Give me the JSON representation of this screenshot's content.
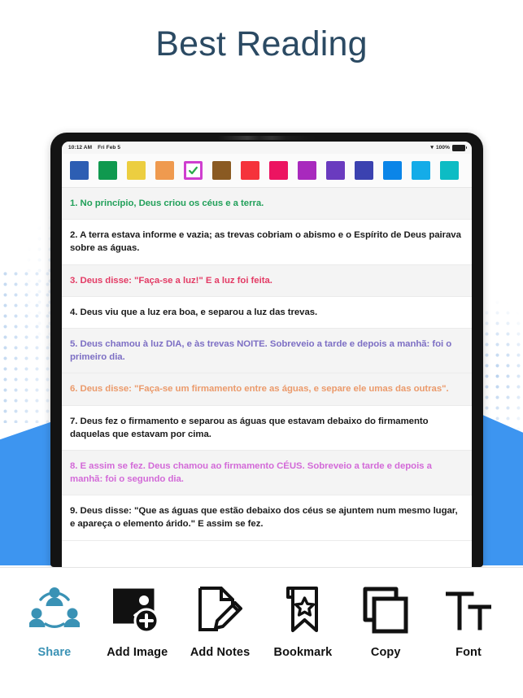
{
  "page": {
    "title": "Best Reading",
    "title_color": "#2b4a63",
    "accent_blue": "#3d95f0",
    "share_accent": "#3a92b5"
  },
  "tablet": {
    "status_bar": {
      "time": "10:12 AM",
      "date": "Fri Feb 5",
      "wifi_icon": "wifi-icon",
      "battery_percent": "100%",
      "battery_icon": "battery-full-icon"
    },
    "palette": {
      "swatches": [
        {
          "name": "blue",
          "color": "#2d5eb3",
          "selected": false
        },
        {
          "name": "green",
          "color": "#10994f",
          "selected": false
        },
        {
          "name": "yellow",
          "color": "#ecce40",
          "selected": false
        },
        {
          "name": "orange",
          "color": "#ef9a4f",
          "selected": false
        },
        {
          "name": "white-check",
          "color": "#ffffff",
          "selected": true,
          "border": "#cf3ecf",
          "check_color": "#2bab4a"
        },
        {
          "name": "brown",
          "color": "#8a5a22",
          "selected": false
        },
        {
          "name": "red",
          "color": "#f5333b",
          "selected": false
        },
        {
          "name": "pink",
          "color": "#ec1461",
          "selected": false
        },
        {
          "name": "magenta",
          "color": "#a829bd",
          "selected": false
        },
        {
          "name": "purple",
          "color": "#6a3bbf",
          "selected": false
        },
        {
          "name": "indigo",
          "color": "#3b42b0",
          "selected": false
        },
        {
          "name": "azure",
          "color": "#0b85e8",
          "selected": false
        },
        {
          "name": "sky",
          "color": "#14ace8",
          "selected": false
        },
        {
          "name": "teal",
          "color": "#0dbcc4",
          "selected": false
        }
      ]
    },
    "verses": [
      {
        "number": "1",
        "text": "1. No princípio, Deus criou os céus e a terra.",
        "color": "#22a05a",
        "background": "shade"
      },
      {
        "number": "2",
        "text": "2. A terra estava informe e vazia; as trevas cobriam o abismo e o Espírito de Deus pairava sobre as águas.",
        "color": "#1b1b1b",
        "background": "plain"
      },
      {
        "number": "3",
        "text": "3. Deus disse: \"Faça-se a luz!\" E a luz foi feita.",
        "color": "#e33b65",
        "background": "shade"
      },
      {
        "number": "4",
        "text": "4. Deus viu que a luz era boa, e separou a luz das trevas.",
        "color": "#1b1b1b",
        "background": "plain"
      },
      {
        "number": "5",
        "text": "5. Deus chamou à luz DIA, e às trevas NOITE. Sobreveio a tarde e depois a manhã: foi o primeiro dia.",
        "color": "#7d6fc4",
        "background": "shade"
      },
      {
        "number": "6",
        "text": "6. Deus disse: \"Faça-se um firmamento entre as águas, e separe ele umas das outras\".",
        "color": "#eb9a6b",
        "background": "shade"
      },
      {
        "number": "7",
        "text": "7. Deus fez o firmamento e separou as águas que estavam debaixo do firmamento daquelas que estavam por cima.",
        "color": "#1b1b1b",
        "background": "plain"
      },
      {
        "number": "8",
        "text": "8. E assim se fez. Deus chamou ao firmamento CÉUS. Sobreveio a tarde e depois a manhã: foi o segundo dia.",
        "color": "#d36ad8",
        "background": "shade"
      },
      {
        "number": "9",
        "text": "9. Deus disse: \"Que as águas que estão debaixo dos céus se ajuntem num mesmo lugar, e apareça o elemento árido.\" E assim se fez.",
        "color": "#1b1b1b",
        "background": "plain"
      }
    ]
  },
  "toolbar": {
    "items": [
      {
        "label": "Share",
        "icon": "share-people-icon",
        "active": true
      },
      {
        "label": "Add Image",
        "icon": "add-image-icon",
        "active": false
      },
      {
        "label": "Add Notes",
        "icon": "add-notes-icon",
        "active": false
      },
      {
        "label": "Bookmark",
        "icon": "bookmark-star-icon",
        "active": false
      },
      {
        "label": "Copy",
        "icon": "copy-icon",
        "active": false
      },
      {
        "label": "Font",
        "icon": "font-size-icon",
        "active": false
      }
    ]
  }
}
